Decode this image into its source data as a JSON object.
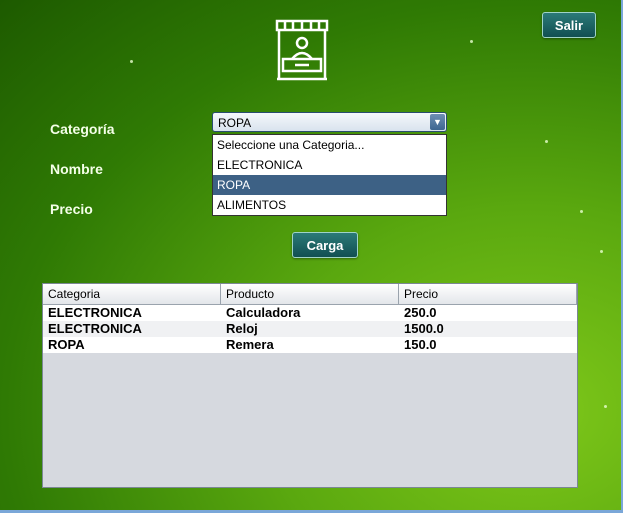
{
  "header": {
    "exit_label": "Salir",
    "logo_icon": "market-stall-icon"
  },
  "form": {
    "category_label": "Categoría",
    "name_label": "Nombre",
    "price_label": "Precio",
    "category_selected": "ROPA",
    "category_options": [
      "Seleccione una Categoria...",
      "ELECTRONICA",
      "ROPA",
      "ALIMENTOS"
    ],
    "submit_label": "Carga"
  },
  "table": {
    "columns": [
      "Categoria",
      "Producto",
      "Precio"
    ],
    "rows": [
      [
        "ELECTRONICA",
        "Calculadora",
        "250.0"
      ],
      [
        "ELECTRONICA",
        "Reloj",
        "1500.0"
      ],
      [
        "ROPA",
        "Remera",
        "150.0"
      ]
    ]
  },
  "colors": {
    "accent": "#114f52",
    "selection": "#3d6185",
    "background": "#2f7a04"
  }
}
